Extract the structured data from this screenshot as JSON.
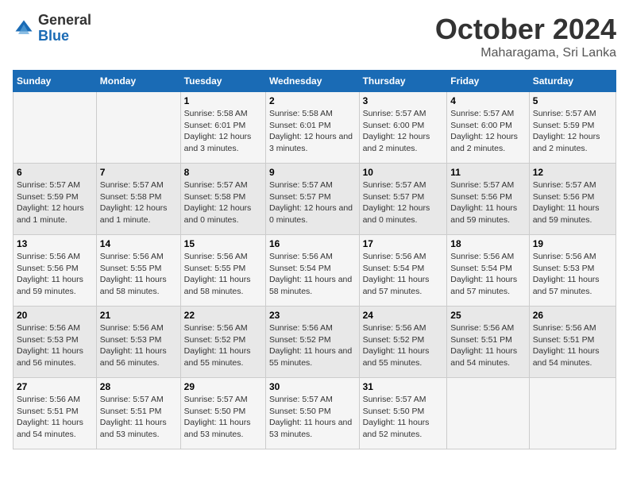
{
  "logo": {
    "general": "General",
    "blue": "Blue"
  },
  "title": "October 2024",
  "location": "Maharagama, Sri Lanka",
  "days_of_week": [
    "Sunday",
    "Monday",
    "Tuesday",
    "Wednesday",
    "Thursday",
    "Friday",
    "Saturday"
  ],
  "weeks": [
    [
      {
        "day": null,
        "info": ""
      },
      {
        "day": null,
        "info": ""
      },
      {
        "day": "1",
        "sunrise": "Sunrise: 5:58 AM",
        "sunset": "Sunset: 6:01 PM",
        "daylight": "Daylight: 12 hours and 3 minutes."
      },
      {
        "day": "2",
        "sunrise": "Sunrise: 5:58 AM",
        "sunset": "Sunset: 6:01 PM",
        "daylight": "Daylight: 12 hours and 3 minutes."
      },
      {
        "day": "3",
        "sunrise": "Sunrise: 5:57 AM",
        "sunset": "Sunset: 6:00 PM",
        "daylight": "Daylight: 12 hours and 2 minutes."
      },
      {
        "day": "4",
        "sunrise": "Sunrise: 5:57 AM",
        "sunset": "Sunset: 6:00 PM",
        "daylight": "Daylight: 12 hours and 2 minutes."
      },
      {
        "day": "5",
        "sunrise": "Sunrise: 5:57 AM",
        "sunset": "Sunset: 5:59 PM",
        "daylight": "Daylight: 12 hours and 2 minutes."
      }
    ],
    [
      {
        "day": "6",
        "sunrise": "Sunrise: 5:57 AM",
        "sunset": "Sunset: 5:59 PM",
        "daylight": "Daylight: 12 hours and 1 minute."
      },
      {
        "day": "7",
        "sunrise": "Sunrise: 5:57 AM",
        "sunset": "Sunset: 5:58 PM",
        "daylight": "Daylight: 12 hours and 1 minute."
      },
      {
        "day": "8",
        "sunrise": "Sunrise: 5:57 AM",
        "sunset": "Sunset: 5:58 PM",
        "daylight": "Daylight: 12 hours and 0 minutes."
      },
      {
        "day": "9",
        "sunrise": "Sunrise: 5:57 AM",
        "sunset": "Sunset: 5:57 PM",
        "daylight": "Daylight: 12 hours and 0 minutes."
      },
      {
        "day": "10",
        "sunrise": "Sunrise: 5:57 AM",
        "sunset": "Sunset: 5:57 PM",
        "daylight": "Daylight: 12 hours and 0 minutes."
      },
      {
        "day": "11",
        "sunrise": "Sunrise: 5:57 AM",
        "sunset": "Sunset: 5:56 PM",
        "daylight": "Daylight: 11 hours and 59 minutes."
      },
      {
        "day": "12",
        "sunrise": "Sunrise: 5:57 AM",
        "sunset": "Sunset: 5:56 PM",
        "daylight": "Daylight: 11 hours and 59 minutes."
      }
    ],
    [
      {
        "day": "13",
        "sunrise": "Sunrise: 5:56 AM",
        "sunset": "Sunset: 5:56 PM",
        "daylight": "Daylight: 11 hours and 59 minutes."
      },
      {
        "day": "14",
        "sunrise": "Sunrise: 5:56 AM",
        "sunset": "Sunset: 5:55 PM",
        "daylight": "Daylight: 11 hours and 58 minutes."
      },
      {
        "day": "15",
        "sunrise": "Sunrise: 5:56 AM",
        "sunset": "Sunset: 5:55 PM",
        "daylight": "Daylight: 11 hours and 58 minutes."
      },
      {
        "day": "16",
        "sunrise": "Sunrise: 5:56 AM",
        "sunset": "Sunset: 5:54 PM",
        "daylight": "Daylight: 11 hours and 58 minutes."
      },
      {
        "day": "17",
        "sunrise": "Sunrise: 5:56 AM",
        "sunset": "Sunset: 5:54 PM",
        "daylight": "Daylight: 11 hours and 57 minutes."
      },
      {
        "day": "18",
        "sunrise": "Sunrise: 5:56 AM",
        "sunset": "Sunset: 5:54 PM",
        "daylight": "Daylight: 11 hours and 57 minutes."
      },
      {
        "day": "19",
        "sunrise": "Sunrise: 5:56 AM",
        "sunset": "Sunset: 5:53 PM",
        "daylight": "Daylight: 11 hours and 57 minutes."
      }
    ],
    [
      {
        "day": "20",
        "sunrise": "Sunrise: 5:56 AM",
        "sunset": "Sunset: 5:53 PM",
        "daylight": "Daylight: 11 hours and 56 minutes."
      },
      {
        "day": "21",
        "sunrise": "Sunrise: 5:56 AM",
        "sunset": "Sunset: 5:53 PM",
        "daylight": "Daylight: 11 hours and 56 minutes."
      },
      {
        "day": "22",
        "sunrise": "Sunrise: 5:56 AM",
        "sunset": "Sunset: 5:52 PM",
        "daylight": "Daylight: 11 hours and 55 minutes."
      },
      {
        "day": "23",
        "sunrise": "Sunrise: 5:56 AM",
        "sunset": "Sunset: 5:52 PM",
        "daylight": "Daylight: 11 hours and 55 minutes."
      },
      {
        "day": "24",
        "sunrise": "Sunrise: 5:56 AM",
        "sunset": "Sunset: 5:52 PM",
        "daylight": "Daylight: 11 hours and 55 minutes."
      },
      {
        "day": "25",
        "sunrise": "Sunrise: 5:56 AM",
        "sunset": "Sunset: 5:51 PM",
        "daylight": "Daylight: 11 hours and 54 minutes."
      },
      {
        "day": "26",
        "sunrise": "Sunrise: 5:56 AM",
        "sunset": "Sunset: 5:51 PM",
        "daylight": "Daylight: 11 hours and 54 minutes."
      }
    ],
    [
      {
        "day": "27",
        "sunrise": "Sunrise: 5:56 AM",
        "sunset": "Sunset: 5:51 PM",
        "daylight": "Daylight: 11 hours and 54 minutes."
      },
      {
        "day": "28",
        "sunrise": "Sunrise: 5:57 AM",
        "sunset": "Sunset: 5:51 PM",
        "daylight": "Daylight: 11 hours and 53 minutes."
      },
      {
        "day": "29",
        "sunrise": "Sunrise: 5:57 AM",
        "sunset": "Sunset: 5:50 PM",
        "daylight": "Daylight: 11 hours and 53 minutes."
      },
      {
        "day": "30",
        "sunrise": "Sunrise: 5:57 AM",
        "sunset": "Sunset: 5:50 PM",
        "daylight": "Daylight: 11 hours and 53 minutes."
      },
      {
        "day": "31",
        "sunrise": "Sunrise: 5:57 AM",
        "sunset": "Sunset: 5:50 PM",
        "daylight": "Daylight: 11 hours and 52 minutes."
      },
      {
        "day": null,
        "info": ""
      },
      {
        "day": null,
        "info": ""
      }
    ]
  ]
}
